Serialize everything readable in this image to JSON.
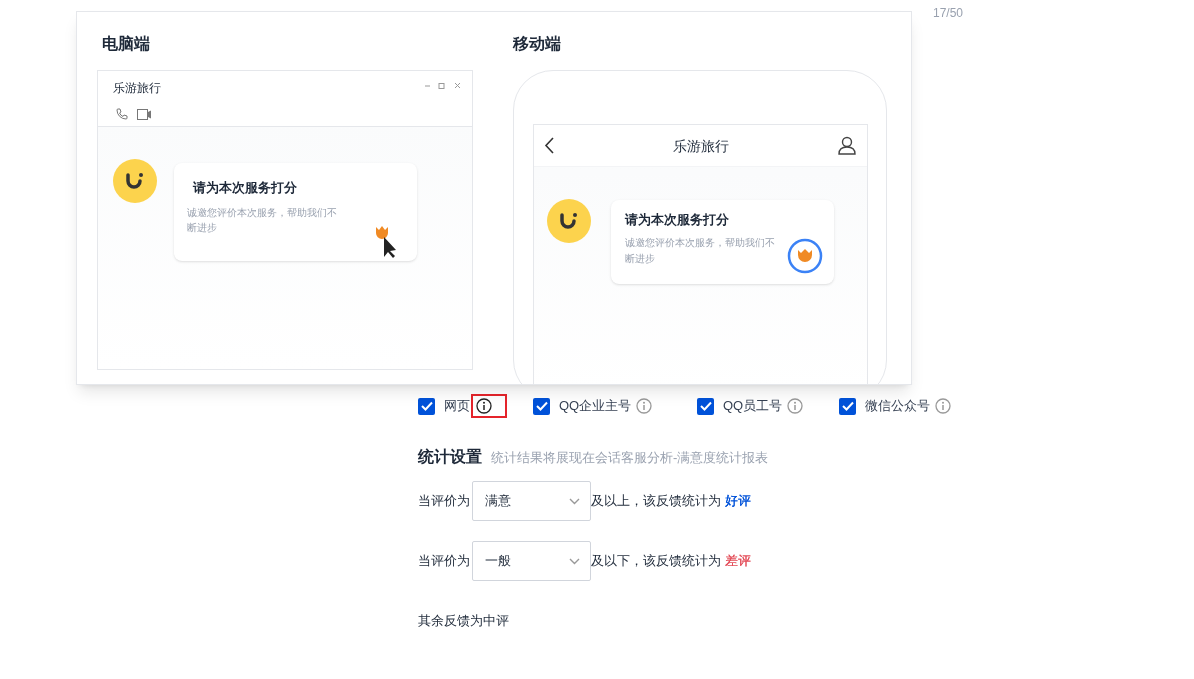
{
  "page_counter": "17/50",
  "preview": {
    "desktop": {
      "heading": "电脑端",
      "window_title": "乐游旅行",
      "card_title": "请为本次服务打分",
      "card_text": "诚邀您评价本次服务，帮助我们不断进步"
    },
    "mobile": {
      "heading": "移动端",
      "nav_title": "乐游旅行",
      "card_title": "请为本次服务打分",
      "card_text": "诚邀您评价本次服务，帮助我们不断进步"
    }
  },
  "channels": [
    {
      "label": "网页",
      "checked": true,
      "highlighted": true
    },
    {
      "label": "QQ企业主号",
      "checked": true,
      "highlighted": false
    },
    {
      "label": "QQ员工号",
      "checked": true,
      "highlighted": false
    },
    {
      "label": "微信公众号",
      "checked": true,
      "highlighted": false
    }
  ],
  "stats": {
    "title": "统计设置",
    "hint": "统计结果将展现在会话客服分析-满意度统计报表",
    "rules": [
      {
        "prefix": "当评价为",
        "value": "满意",
        "suffix": "及以上，该反馈统计为",
        "result": "好评",
        "color": "#0052d9"
      },
      {
        "prefix": "当评价为",
        "value": "一般",
        "suffix": "及以下，该反馈统计为",
        "result": "差评",
        "color": "#e34d59"
      }
    ],
    "footer": "其余反馈为中评"
  }
}
